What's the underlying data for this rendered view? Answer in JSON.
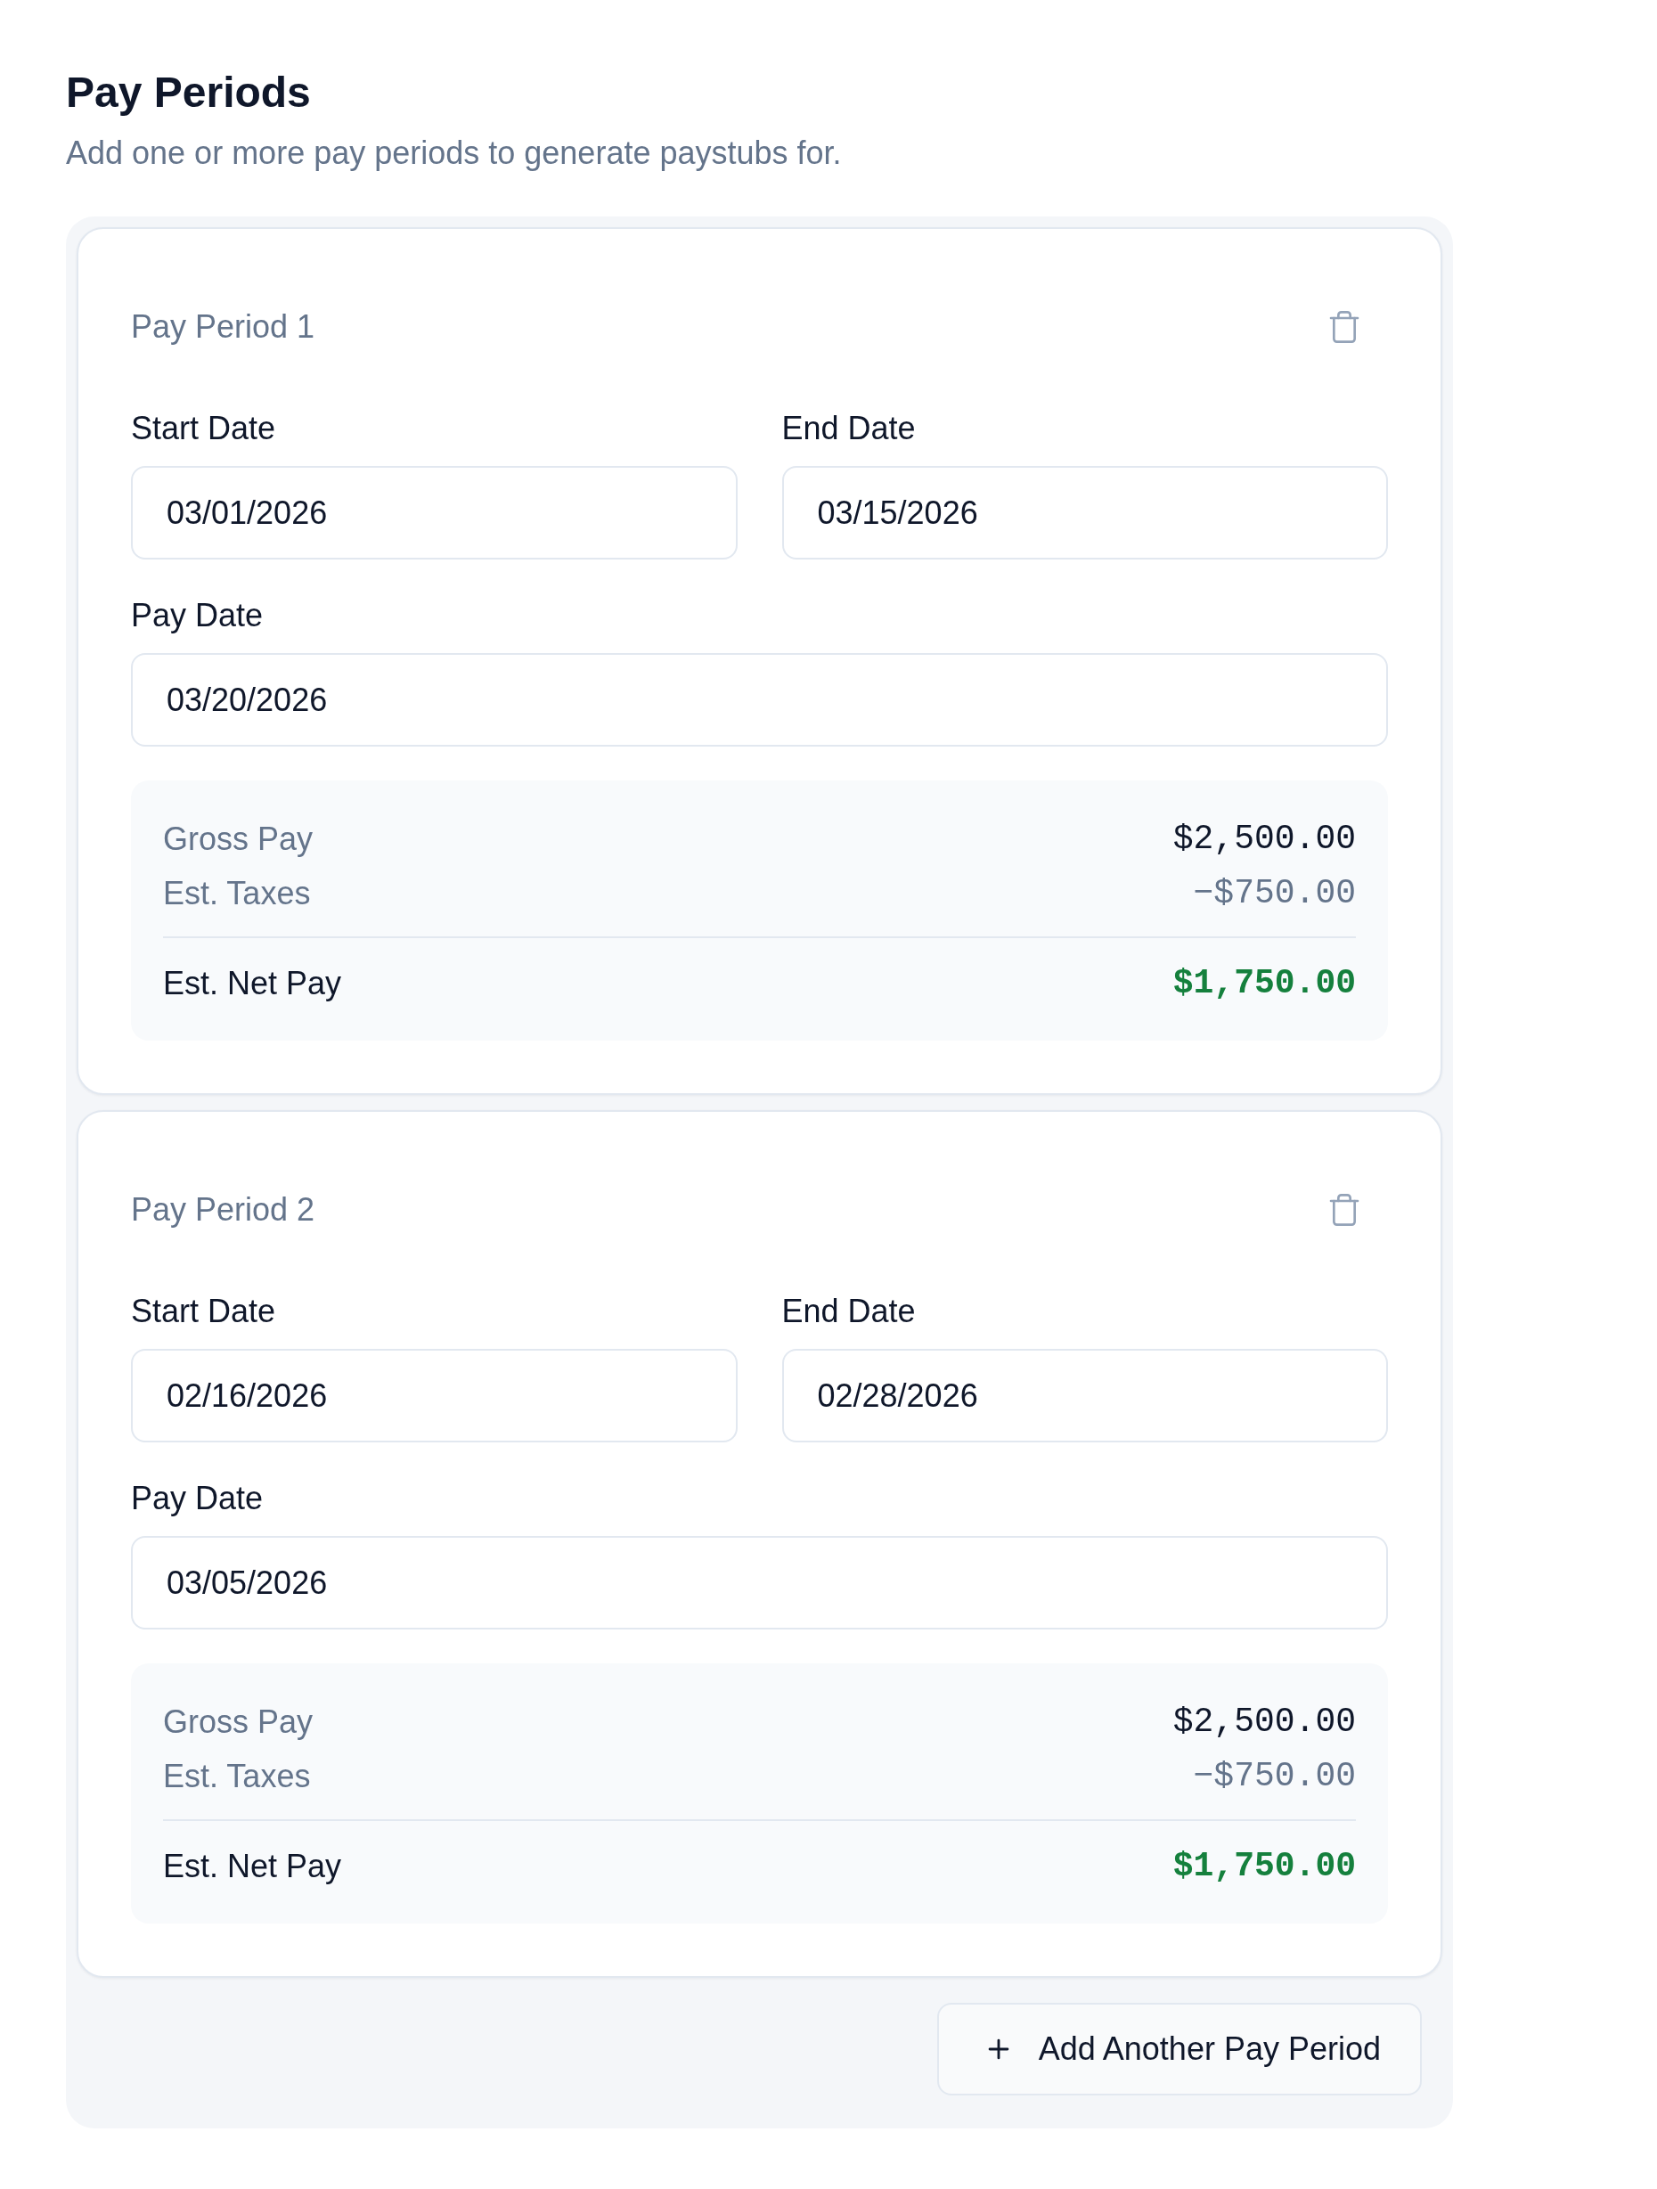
{
  "header": {
    "title": "Pay Periods",
    "subtitle": "Add one or more pay periods to generate paystubs for."
  },
  "periods": [
    {
      "title": "Pay Period 1",
      "field_rows": [
        [
          {
            "label": "Start Date",
            "value": "03/01/2026"
          },
          {
            "label": "End Date",
            "value": "03/15/2026"
          }
        ],
        [
          {
            "label": "Pay Date",
            "value": "03/20/2026"
          }
        ]
      ],
      "summary": {
        "rows": [
          {
            "kind": "gross",
            "label": "Gross Pay",
            "value": "$2,500.00"
          },
          {
            "kind": "deduction",
            "label": "Est. Taxes",
            "value": "−$750.00"
          }
        ],
        "total": {
          "label": "Est. Net Pay",
          "value": "$1,750.00"
        }
      }
    },
    {
      "title": "Pay Period 2",
      "field_rows": [
        [
          {
            "label": "Start Date",
            "value": "02/16/2026"
          },
          {
            "label": "End Date",
            "value": "02/28/2026"
          }
        ],
        [
          {
            "label": "Pay Date",
            "value": "03/05/2026"
          }
        ]
      ],
      "summary": {
        "rows": [
          {
            "kind": "gross",
            "label": "Gross Pay",
            "value": "$2,500.00"
          },
          {
            "kind": "deduction",
            "label": "Est. Taxes",
            "value": "−$750.00"
          }
        ],
        "total": {
          "label": "Est. Net Pay",
          "value": "$1,750.00"
        }
      }
    }
  ],
  "add_button": {
    "label": "Add Another Pay Period"
  }
}
